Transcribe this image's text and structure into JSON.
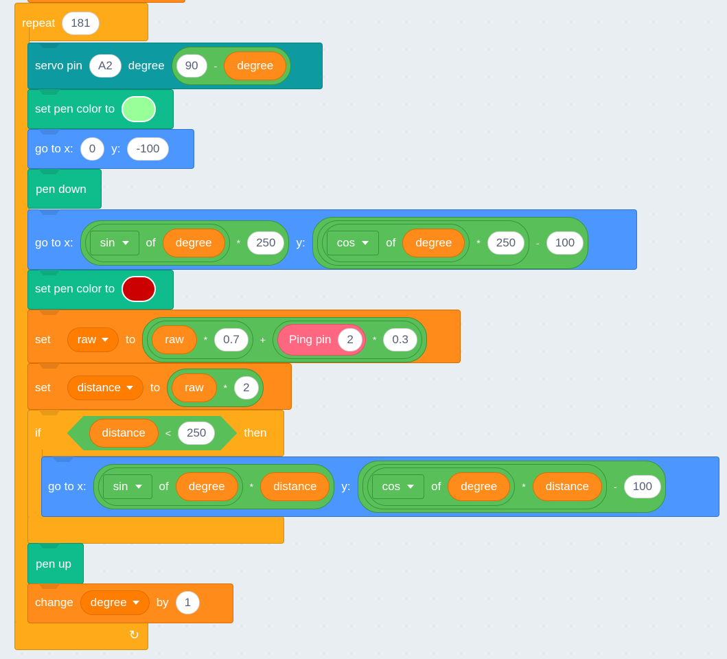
{
  "repeat": {
    "label": "repeat",
    "count": "181",
    "loop_icon": "↺"
  },
  "servo": {
    "label_a": "servo pin",
    "pin": "A2",
    "label_b": "degree",
    "value": "90",
    "op": "-",
    "var": "degree"
  },
  "pen_color_1": {
    "label": "set pen color to",
    "color": "#99ff99"
  },
  "goto_1": {
    "label_x": "go to x:",
    "x": "0",
    "label_y": "y:",
    "y": "-100"
  },
  "pen_down": {
    "label": "pen down"
  },
  "goto_2": {
    "label_x": "go to x:",
    "x_fn": "sin",
    "of": "of",
    "x_var": "degree",
    "x_op": "*",
    "x_mult": "250",
    "label_y": "y:",
    "y_fn": "cos",
    "y_var": "degree",
    "y_op": "*",
    "y_mult": "250",
    "y_op2": "-",
    "y_sub": "100"
  },
  "pen_color_2": {
    "label": "set pen color to",
    "color": "#cc0000"
  },
  "set_raw": {
    "label": "set",
    "var": "raw",
    "to": "to",
    "term1_var": "raw",
    "op1": "*",
    "val1": "0.7",
    "plus": "+",
    "ping_label": "Ping pin",
    "ping_pin": "2",
    "op2": "*",
    "val2": "0.3"
  },
  "set_distance": {
    "label": "set",
    "var": "distance",
    "to": "to",
    "term_var": "raw",
    "op": "*",
    "val": "2"
  },
  "if_block": {
    "label": "if",
    "var": "distance",
    "op": "<",
    "val": "250",
    "then": "then"
  },
  "goto_3": {
    "label_x": "go to x:",
    "x_fn": "sin",
    "of": "of",
    "x_var": "degree",
    "x_op": "*",
    "x_mult": "distance",
    "label_y": "y:",
    "y_fn": "cos",
    "y_var": "degree",
    "y_op": "*",
    "y_mult": "distance",
    "y_op2": "-",
    "y_sub": "100"
  },
  "pen_up": {
    "label": "pen up"
  },
  "change": {
    "label": "change",
    "var": "degree",
    "by": "by",
    "val": "1"
  }
}
